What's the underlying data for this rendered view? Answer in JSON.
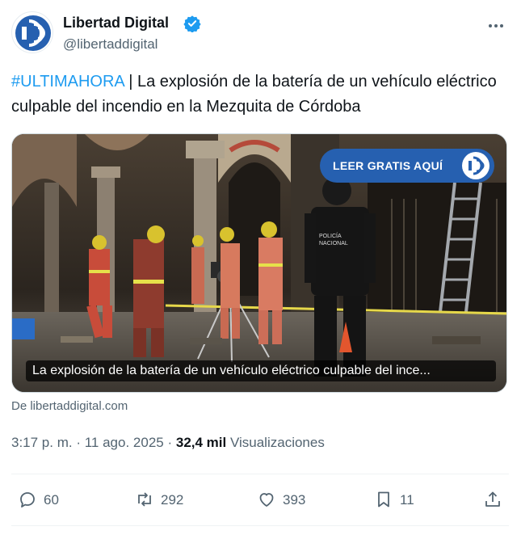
{
  "author": {
    "name": "Libertad Digital",
    "handle": "@libertaddigital",
    "verified": true,
    "avatar_icon": "libertad-digital-logo"
  },
  "tweet": {
    "hashtag": "#ULTIMAHORA",
    "text": " | La explosión de la batería de un vehículo eléctrico culpable del incendio en la Mezquita de Córdoba"
  },
  "media": {
    "caption": "La explosión de la batería de un vehículo eléctrico culpable del ince...",
    "cta_label": "LEER GRATIS AQUÍ",
    "police_text": "POLICÍA NACIONAL"
  },
  "source": "De libertaddigital.com",
  "meta": {
    "time": "3:17 p. m.",
    "date": "11 ago. 2025",
    "views": "32,4 mil",
    "views_label": "Visualizaciones"
  },
  "actions": {
    "replies": "60",
    "reposts": "292",
    "likes": "393",
    "bookmarks": "11"
  },
  "colors": {
    "accent": "#1d9bf0",
    "brand": "#2660b0",
    "secondary_text": "#536471"
  }
}
